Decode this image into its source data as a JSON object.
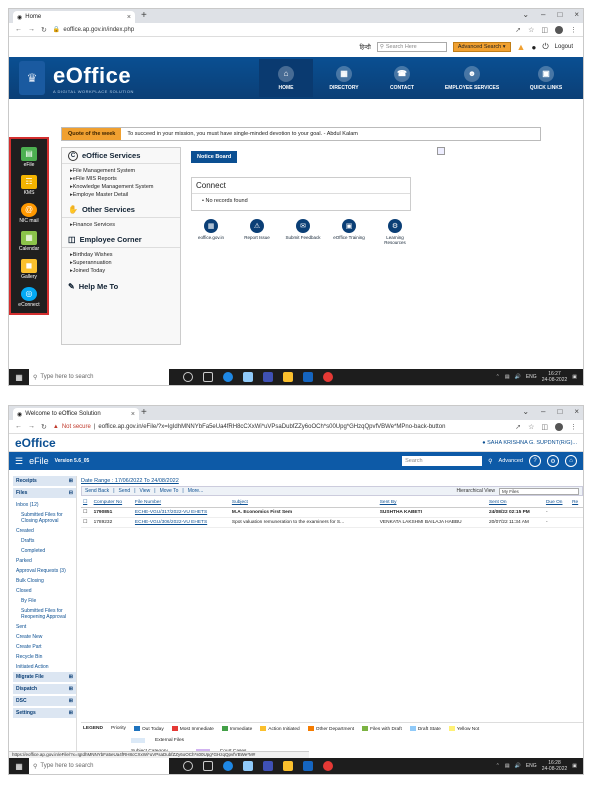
{
  "shot1": {
    "tab_title": "Home",
    "url": "eoffice.ap.gov.in/index.php",
    "top_hindi": "हिन्दी",
    "search_placeholder": "Search Here",
    "advanced_search": "Advanced Search",
    "logout": "Logout",
    "brand_name": "eOffice",
    "brand_tag": "A DIGITAL WORKPLACE SOLUTION",
    "nav": [
      {
        "label": "HOME"
      },
      {
        "label": "DIRECTORY"
      },
      {
        "label": "CONTACT"
      },
      {
        "label": "EMPLOYEE SERVICES"
      },
      {
        "label": "QUICK LINKS"
      }
    ],
    "rail": [
      {
        "label": "eFile",
        "color": "#4caf50"
      },
      {
        "label": "KMS",
        "color": "#f4b400"
      },
      {
        "label": "NIC mail",
        "color": "#ff9800"
      },
      {
        "label": "Calendar",
        "color": "#8bc34a"
      },
      {
        "label": "Gallery",
        "color": "#fbc02d"
      },
      {
        "label": "eConnect",
        "color": "#03a9f4"
      }
    ],
    "quote_label": "Quote of the week",
    "quote_text": "To succeed in your mission, you must have single-minded devotion to your goal. - Abdul Kalam",
    "services_title": "eOffice Services",
    "services_items": [
      "File Management System",
      "eFile MIS Reports",
      "Knowledge Management System",
      "Employe Master Detail"
    ],
    "other_title": "Other Services",
    "other_items": [
      "Finance Services"
    ],
    "corner_title": "Employee Corner",
    "corner_items": [
      "Birthday Wishes",
      "Superannuation",
      "Joined Today"
    ],
    "help_title": "Help Me To",
    "notice_board": "Notice Board",
    "connect_title": "Connect",
    "connect_empty": "No records found",
    "quick_links": [
      "eoffice.gov.in",
      "Report Issue",
      "Submit Feedback",
      "eOffice Training",
      "Learning Resources"
    ],
    "taskbar_search": "Type here to search",
    "lang": "ENG",
    "time": "16:27",
    "date": "24-08-2022"
  },
  "shot2": {
    "tab_title": "Welcome to eOffice Solution",
    "not_secure": "Not secure",
    "url": "eoffice.ap.gov.in/eFile/?x=IgIdhMNNYbFa5eUa4fRH8cCXxWi*uVPsaDubfZZy6oOCh*s00Upg*GHzqQpvfVBWe*MPno-back-button",
    "brand_name": "eOffice",
    "user": "SAHA KRISHNA G. SUPDNT(R/G)...",
    "app_title": "eFile",
    "version": "Version 5.6_05",
    "search": "Search",
    "advanced": "Advanced",
    "sidebar": {
      "receipts": "Receipts",
      "files": "Files",
      "files_items": [
        {
          "label": "Inbox (12)",
          "sub": false
        },
        {
          "label": "Submitted Files for Closing Approval",
          "sub": true
        },
        {
          "label": "Created",
          "sub": false
        },
        {
          "label": "Drafts",
          "sub": true
        },
        {
          "label": "Completed",
          "sub": true
        },
        {
          "label": "Parked",
          "sub": false
        },
        {
          "label": "Approval Requests (3)",
          "sub": false
        },
        {
          "label": "Bulk Closing",
          "sub": false
        },
        {
          "label": "Closed",
          "sub": false
        },
        {
          "label": "By File",
          "sub": true
        },
        {
          "label": "Submitted Files for Reopening Approval",
          "sub": true
        },
        {
          "label": "Sent",
          "sub": false
        },
        {
          "label": "Create New",
          "sub": false
        },
        {
          "label": "Create Part",
          "sub": false
        },
        {
          "label": "Recycle Bin",
          "sub": false
        },
        {
          "label": "Initiated Action",
          "sub": false
        }
      ],
      "bottom": [
        "Migrate File",
        "Dispatch",
        "DSC",
        "Settings"
      ]
    },
    "date_range": "Date Range : 17/06/2022 To 24/08/2022",
    "toolbar": [
      "Send Back",
      "Send",
      "View",
      "Move To",
      "More..."
    ],
    "hierarchical_view": "Hierarchical View",
    "my_files": "My Files",
    "columns": [
      "Computer No",
      "File Number",
      "Subject",
      "Sent By",
      "Sent On",
      "Due On",
      "Re"
    ],
    "rows": [
      {
        "comp": "1790851",
        "file": "ECHE-VGU/317/2022-VU EHETS",
        "subject": "M.A. Economics First Sem",
        "sent_by": "SUSHTHA KABETI",
        "sent_on": "24/08/22 02:15 PM",
        "due": "-",
        "bold": true
      },
      {
        "comp": "1789232",
        "file": "ECHE-VGU/306/2022-VU EHETS",
        "subject": "Spot valuation remuneration to the examiners for S...",
        "sent_by": "VENKATA LAKSHMI BAILAJA HABBU",
        "sent_on": "20/07/22 11:34 AM",
        "due": "-",
        "bold": false
      }
    ],
    "legend_label": "LEGEND",
    "legend": [
      {
        "label": "Priority",
        "color": ""
      },
      {
        "label": "Out Today",
        "color": "#1e73be"
      },
      {
        "label": "Most Immediate",
        "color": "#e53935"
      },
      {
        "label": "Immediate",
        "color": "#43a047"
      },
      {
        "label": "Action Initiated",
        "color": "#fbc02d"
      },
      {
        "label": "Other Department",
        "color": "#f57c00"
      },
      {
        "label": "Files with Draft",
        "color": "#7cb342"
      },
      {
        "label": "Draft State",
        "color": "#90caf9"
      },
      {
        "label": "Yellow Not",
        "color": "#fff176"
      }
    ],
    "external_files": "External Files",
    "subject_category": "Subject Category",
    "court_cases": "Court Cases",
    "status_url": "https://eoffice.ap.gov.in/eFile/?x=IgIdhMNNYbFa5eUa4fRH8cCXxWi*uVPsaDubfZZy6oOCh*s00Upg*GHzqQpvfVBWe*M#",
    "taskbar_search": "Type here to search",
    "lang": "ENG",
    "time": "16:28",
    "date": "24-08-2022"
  }
}
